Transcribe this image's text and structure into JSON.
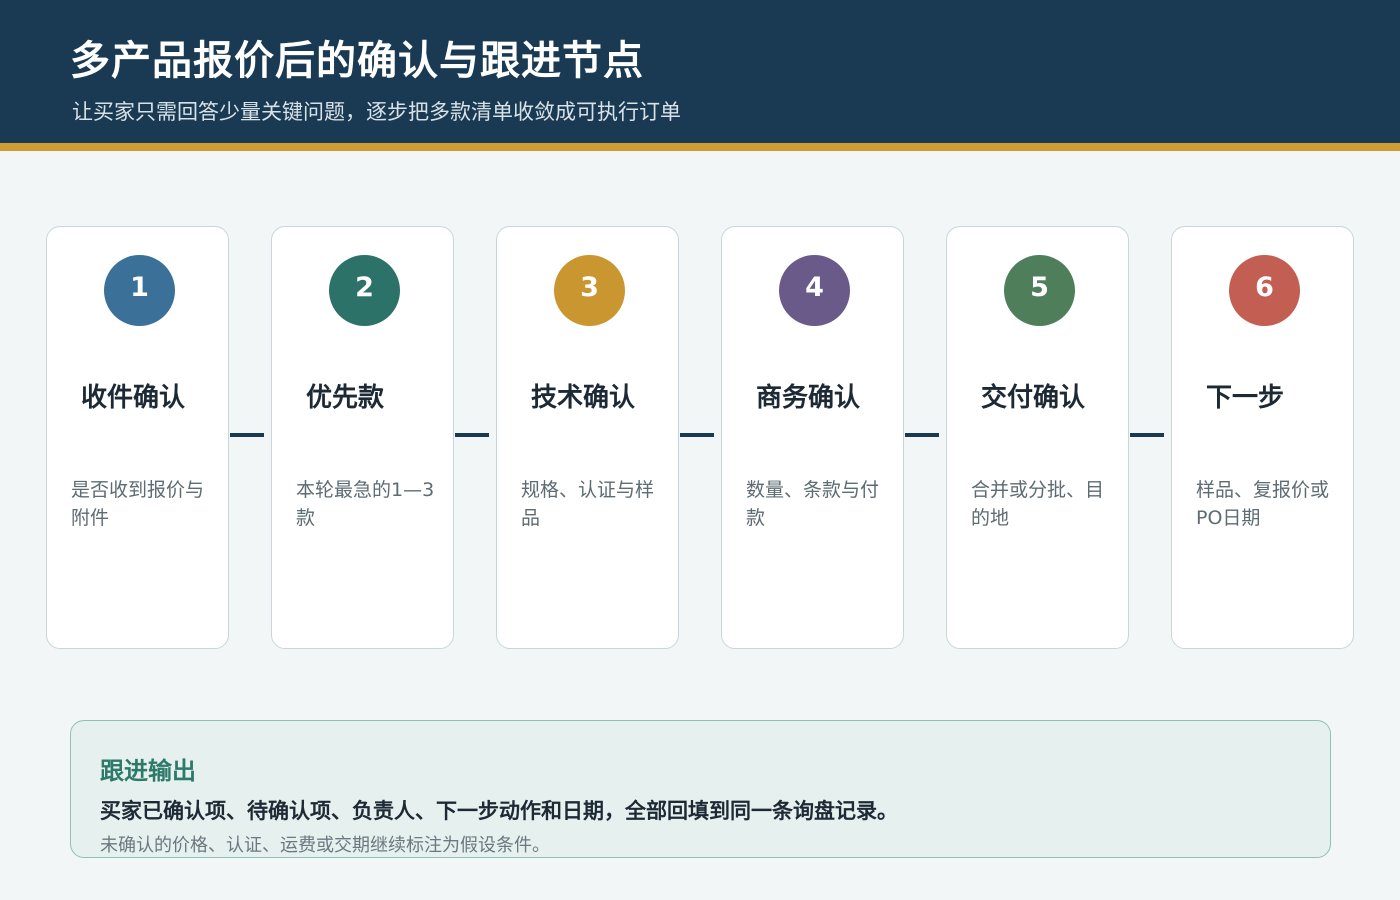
{
  "header": {
    "title": "多产品报价后的确认与跟进节点",
    "subtitle": "让买家只需回答少量关键问题，逐步把多款清单收敛成可执行订单",
    "background_color": "#193a52",
    "accent_color": "#d09c34"
  },
  "steps": [
    {
      "number": "1",
      "title": "收件确认",
      "description": "是否收到报价与附件",
      "color": "#3b7198"
    },
    {
      "number": "2",
      "title": "优先款",
      "description": "本轮最急的1—3款",
      "color": "#2c7268"
    },
    {
      "number": "3",
      "title": "技术确认",
      "description": "规格、认证与样品",
      "color": "#c9962f"
    },
    {
      "number": "4",
      "title": "商务确认",
      "description": "数量、条款与付款",
      "color": "#6a5a8a"
    },
    {
      "number": "5",
      "title": "交付确认",
      "description": "合并或分批、目的地",
      "color": "#4e7f5a"
    },
    {
      "number": "6",
      "title": "下一步",
      "description": "样品、复报价或PO日期",
      "color": "#c25f52"
    }
  ],
  "output": {
    "title": "跟进输出",
    "main_text": "买家已确认项、待确认项、负责人、下一步动作和日期，全部回填到同一条询盘记录。",
    "note": "未确认的价格、认证、运费或交期继续标注为假设条件。"
  }
}
